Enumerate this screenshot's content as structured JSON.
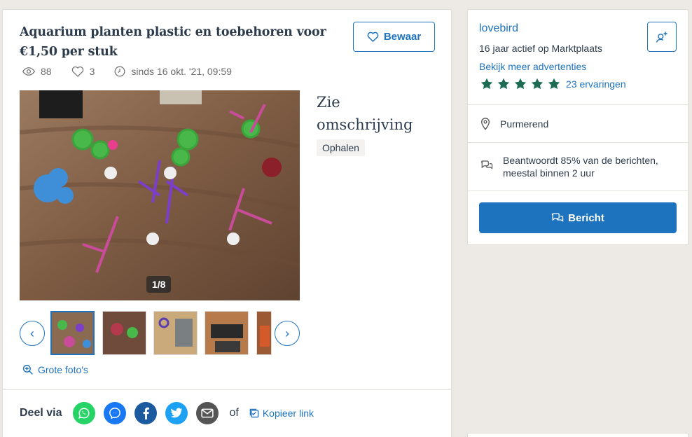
{
  "listing": {
    "title": "Aquarium planten plastic en toebehoren voor €1,50 per stuk",
    "save_label": "Bewaar",
    "views": "88",
    "favorites": "3",
    "since": "sinds 16 okt. '21, 09:59",
    "photo_counter": "1/8",
    "side_title": "Zie omschrijving",
    "tag": "Ophalen",
    "large_photos_label": "Grote foto's"
  },
  "share": {
    "label": "Deel via",
    "or": "of",
    "copy_link": "Kopieer link",
    "colors": {
      "whatsapp": "#25d366",
      "messenger": "#1877f2",
      "facebook": "#1c5aa0",
      "twitter": "#1da1f2",
      "email": "#555555"
    }
  },
  "seller": {
    "name": "lovebird",
    "active": "16 jaar actief op Marktplaats",
    "more_ads": "Bekijk meer advertenties",
    "rating_stars": 5,
    "reviews": "23 ervaringen",
    "location": "Purmerend",
    "response": "Beantwoordt 85% van de berichten, meestal binnen 2 uur",
    "message_button": "Bericht"
  },
  "colors": {
    "accent": "#1e73be",
    "star": "#1d6b55",
    "text": "#2d3c4d",
    "muted": "#6b6b6b"
  },
  "icons": {
    "views": "eye-icon",
    "favorites": "heart-icon",
    "since": "clock-icon",
    "location": "map-pin-icon",
    "response": "chat-bubbles-icon"
  }
}
